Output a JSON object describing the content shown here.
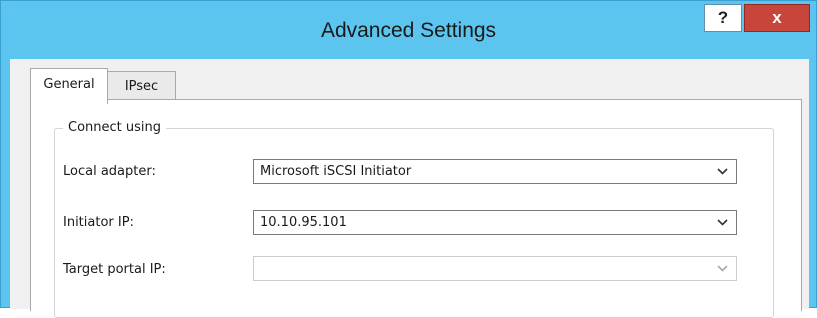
{
  "window": {
    "title": "Advanced Settings",
    "help_label": "?",
    "close_label": "x"
  },
  "tabs": [
    {
      "label": "General",
      "selected": true
    },
    {
      "label": "IPsec",
      "selected": false
    }
  ],
  "group": {
    "label": "Connect using"
  },
  "fields": {
    "local_adapter": {
      "label": "Local adapter:",
      "value": "Microsoft iSCSI Initiator",
      "enabled": true
    },
    "initiator_ip": {
      "label": "Initiator IP:",
      "value": "10.10.95.101",
      "enabled": true
    },
    "target_portal_ip": {
      "label": "Target portal IP:",
      "value": "",
      "enabled": false
    }
  },
  "colors": {
    "titlebar": "#5bc4ef",
    "close_button": "#c8453c"
  }
}
